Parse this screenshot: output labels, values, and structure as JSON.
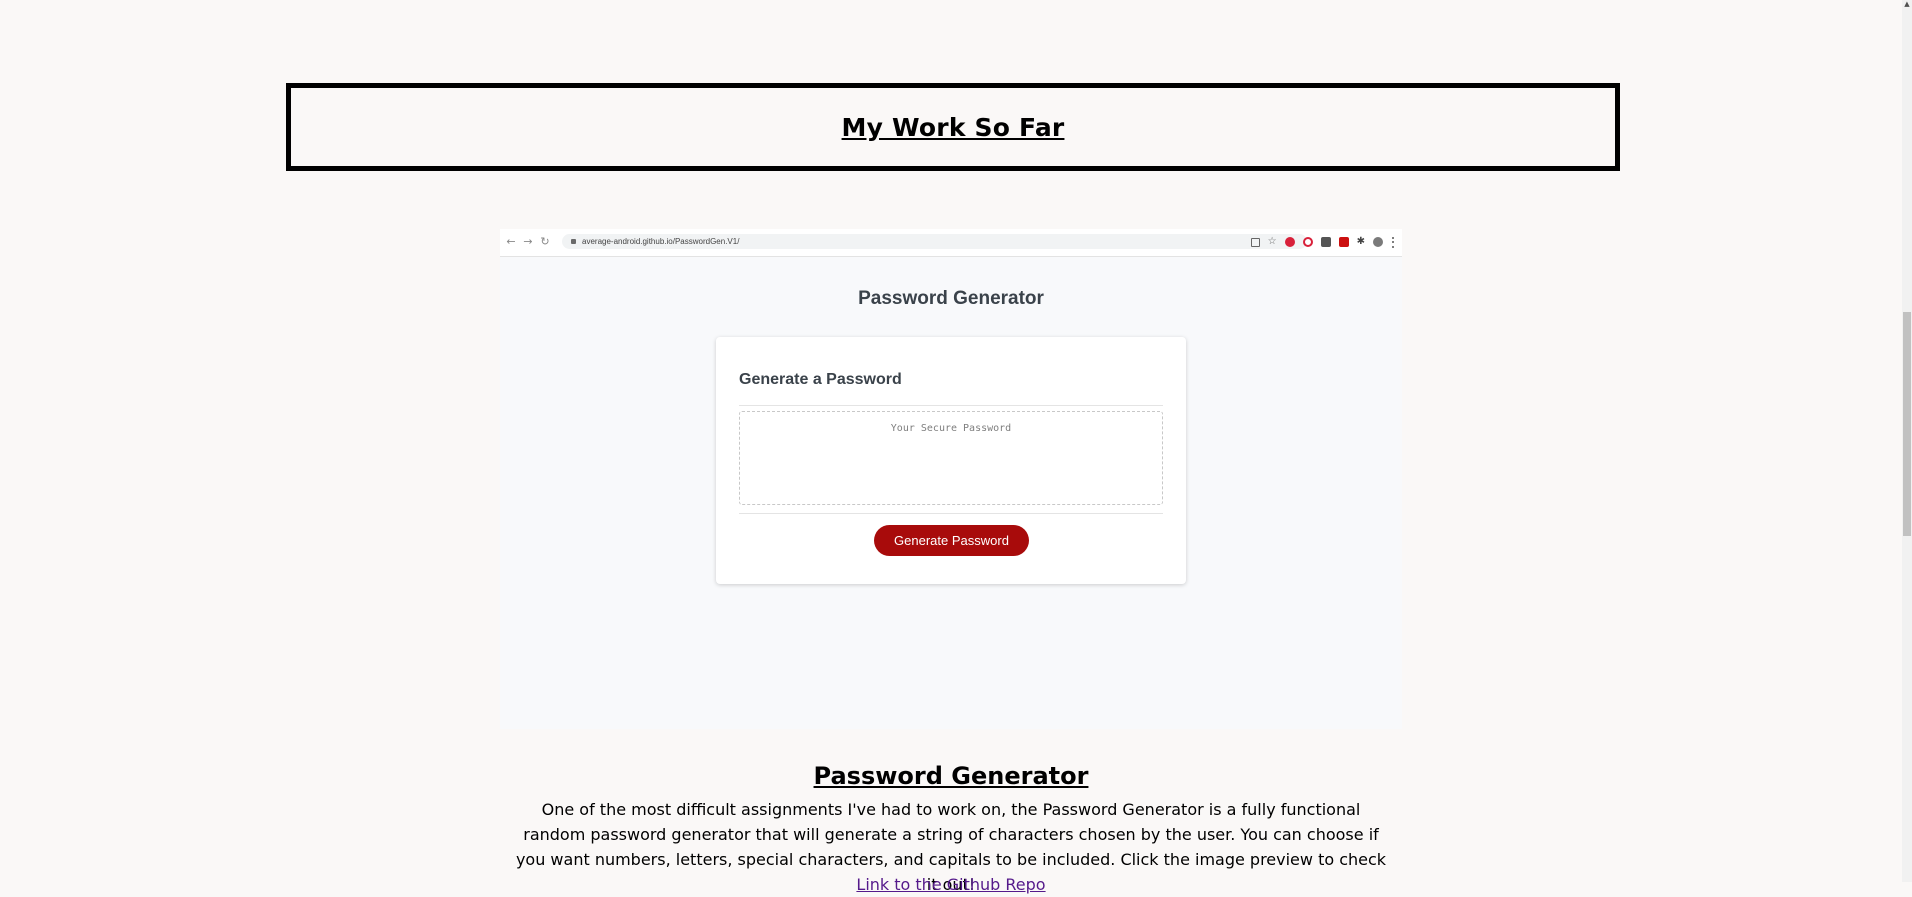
{
  "section": {
    "title": "My Work So Far"
  },
  "preview": {
    "browser": {
      "url": "average-android.github.io/PasswordGen.V1/",
      "back_icon": "arrow-left-icon",
      "forward_icon": "arrow-right-icon",
      "reload_icon": "reload-icon",
      "extension_colors": [
        "#d8203a",
        "#d8203a",
        "#555555",
        "#cc1010",
        "#444444",
        "#7a7a7a"
      ]
    },
    "app_title": "Password Generator",
    "card": {
      "header": "Generate a Password",
      "placeholder": "Your Secure Password",
      "button_label": "Generate Password"
    },
    "accent_color": "#a80b0b"
  },
  "project": {
    "title": "Password Generator",
    "description": "One of the most difficult assignments I've had to work on, the Password Generator is a fully functional random password generator that will generate a string of characters chosen by the user. You can choose if you want numbers, letters, special characters, and capitals to be included. Click the image preview to check it out!",
    "link_text": "Link to the Github Repo"
  }
}
